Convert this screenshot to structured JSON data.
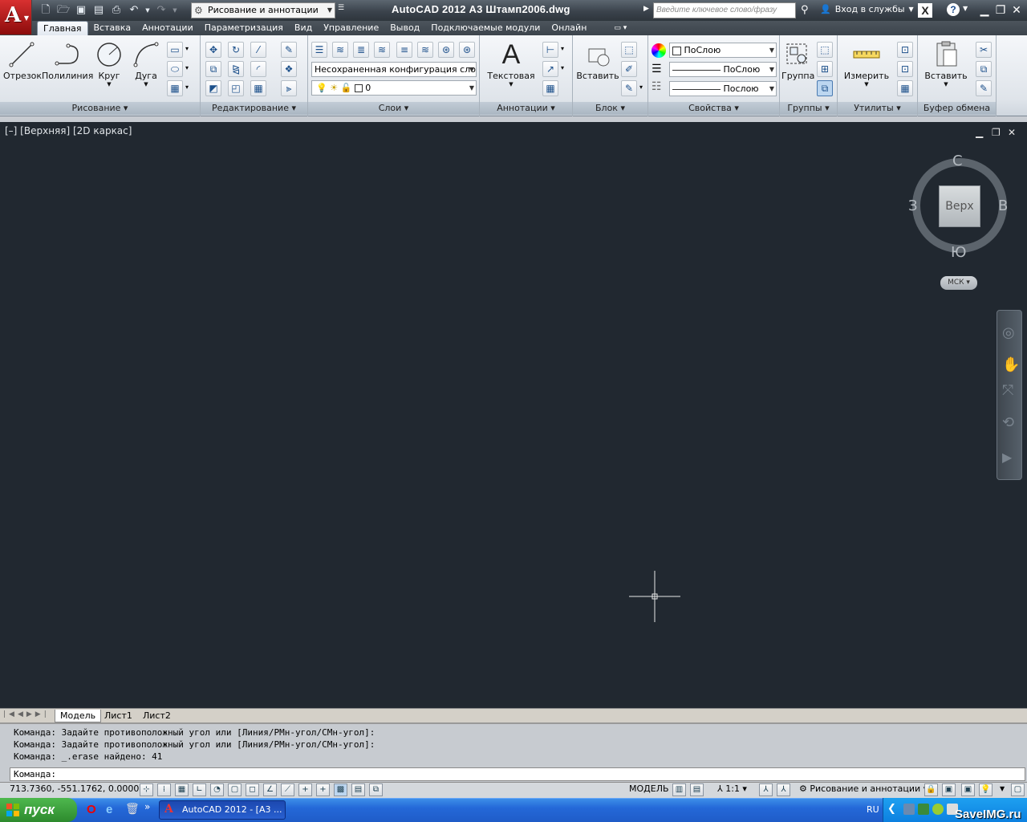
{
  "title_bar": {
    "workspace": "Рисование и аннотации",
    "app_title": "AutoCAD 2012    А3 Штамп2006.dwg",
    "search_placeholder": "Введите ключевое слово/фразу",
    "signin": "Вход в службы"
  },
  "ribbon_tabs": [
    "Главная",
    "Вставка",
    "Аннотации",
    "Параметризация",
    "Вид",
    "Управление",
    "Вывод",
    "Подключаемые модули",
    "Онлайн"
  ],
  "ribbon": {
    "draw": {
      "title": "Рисование",
      "line": "Отрезок",
      "polyline": "Полилиния",
      "circle": "Круг",
      "arc": "Дуга"
    },
    "modify": {
      "title": "Редактирование"
    },
    "layers": {
      "title": "Слои",
      "layer_state": "Несохраненная конфигурация слоев",
      "current_layer": "0"
    },
    "annotation": {
      "title": "Аннотации",
      "text": "Текстовая"
    },
    "block": {
      "title": "Блок",
      "insert": "Вставить"
    },
    "properties": {
      "title": "Свойства",
      "color": "ПоСлою",
      "lineweight": "ПоСлою",
      "linetype": "Послою"
    },
    "groups": {
      "title": "Группы",
      "group": "Группа"
    },
    "utilities": {
      "title": "Утилиты",
      "measure": "Измерить"
    },
    "clipboard": {
      "title": "Буфер обмена",
      "paste": "Вставить"
    }
  },
  "viewport": {
    "label": "[–] [Верхняя] [2D каркас]",
    "viewcube": {
      "n": "С",
      "s": "Ю",
      "w": "З",
      "e": "В",
      "face": "Верх",
      "ucs": "МСК"
    }
  },
  "layout_tabs": [
    "Модель",
    "Лист1",
    "Лист2"
  ],
  "command_history": [
    "Команда: Задайте противоположный угол или [Линия/РМн-угол/СМн-угол]:",
    "Команда: Задайте противоположный угол или [Линия/РМн-угол/СМн-угол]:",
    "Команда: _.erase найдено: 41"
  ],
  "command_prompt": "Команда:",
  "status": {
    "coords": "713.7360,  -551.1762, 0.0000",
    "model": "МОДЕЛЬ",
    "scale": "1:1",
    "workspace": "Рисование и аннотации"
  },
  "taskbar": {
    "start": "пуск",
    "task": "AutoCAD 2012 - [А3 ...",
    "lang": "RU",
    "watermark": "SaveIMG.ru"
  }
}
